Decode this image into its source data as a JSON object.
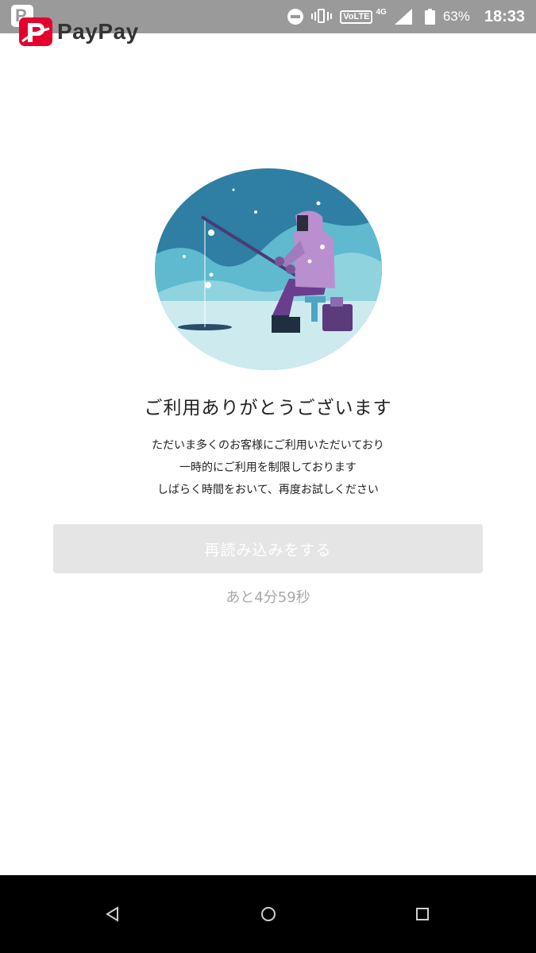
{
  "status_bar": {
    "app_icon_letter": "P",
    "network_label": "VoLTE",
    "network_type": "4G",
    "battery_percent": "63%",
    "time": "18:33"
  },
  "header": {
    "logo_text": "PayPay"
  },
  "main": {
    "title": "ご利用ありがとうございます",
    "message_lines": [
      "ただいま多くのお客様にご利用いただいており",
      "一時的にご利用を制限しております",
      "しばらく時間をおいて、再度お試しください"
    ],
    "reload_button_label": "再読み込みをする",
    "countdown_text": "あと4分59秒"
  },
  "colors": {
    "brand_red": "#e5002d",
    "button_disabled_bg": "#e5e5e5",
    "countdown_gray": "#a8a8a8",
    "status_bar_gray": "#9a9a9a",
    "illustration_sky": "#2f7ea3",
    "illustration_snow": "#cdebef",
    "illustration_figure": "#b98fd0"
  },
  "icons": {
    "status": [
      "dnd-icon",
      "vibrate-icon",
      "signal-icon",
      "battery-icon"
    ],
    "nav": [
      "back-triangle-icon",
      "home-circle-icon",
      "recents-square-icon"
    ]
  }
}
